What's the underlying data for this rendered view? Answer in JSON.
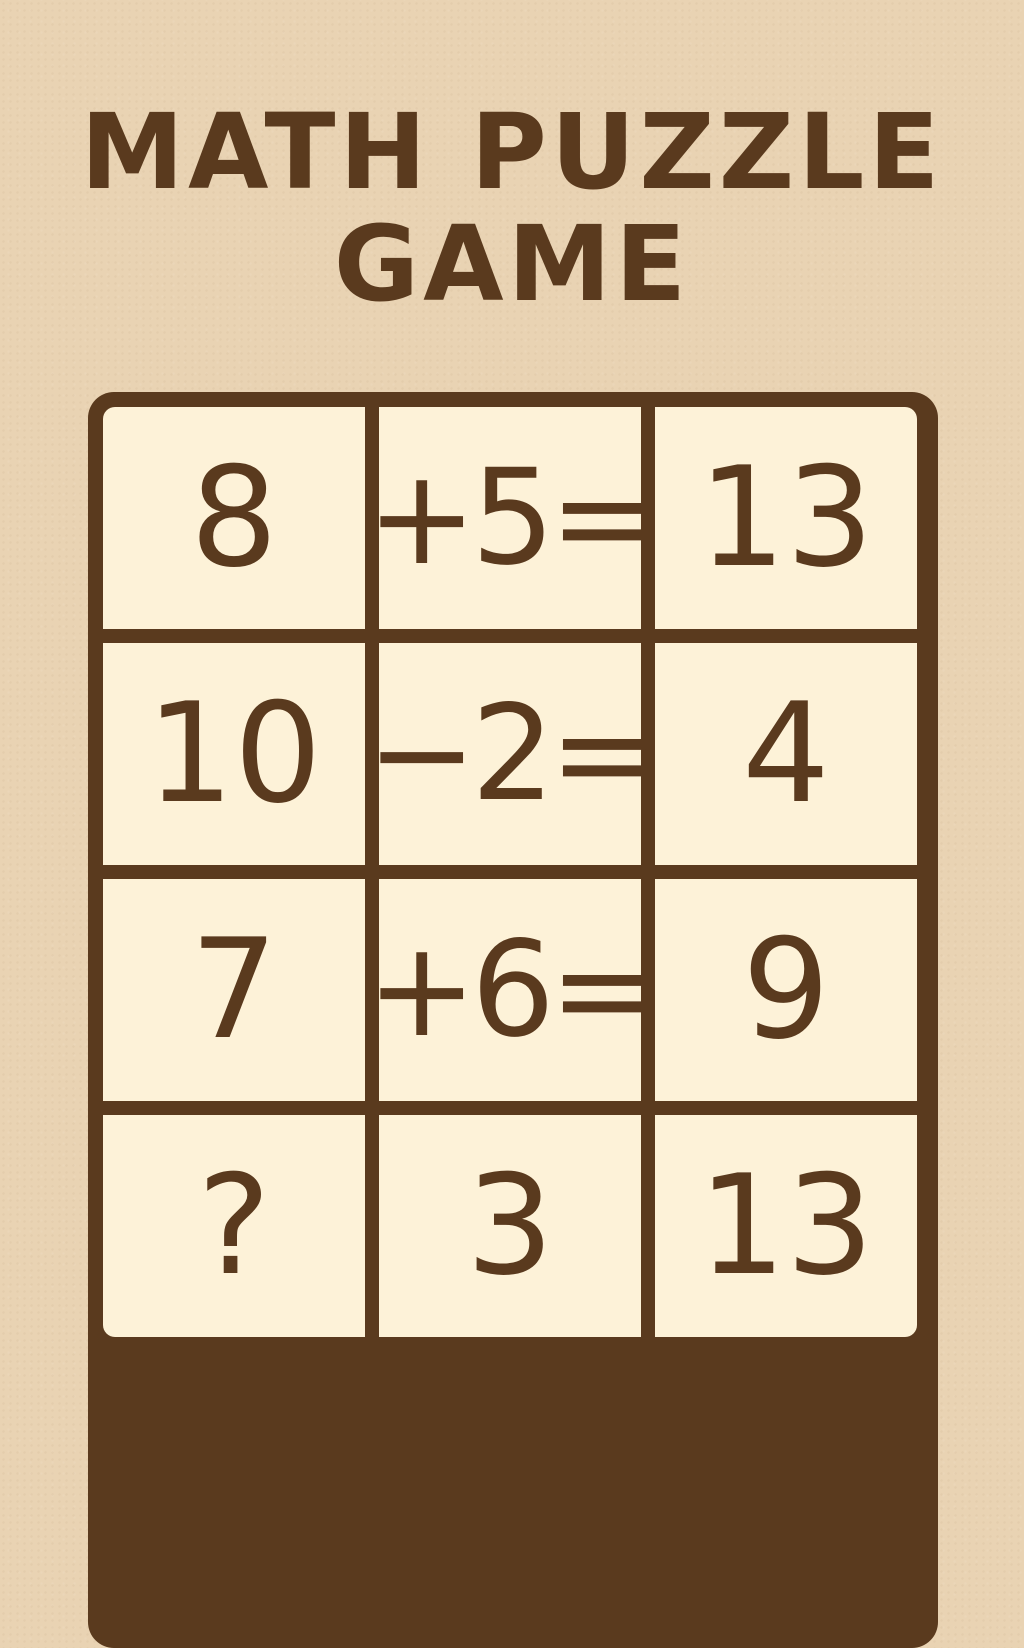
{
  "title": {
    "line1": "MATH PUZZLE",
    "line2": "GAME"
  },
  "grid": {
    "rows": [
      [
        "8",
        "+5=",
        "13"
      ],
      [
        "10",
        "−2=",
        "4"
      ],
      [
        "7",
        "+6=",
        "9"
      ],
      [
        "?",
        "3",
        "13"
      ]
    ]
  },
  "colors": {
    "background": "#e9d3b3",
    "cell": "#fdf2d8",
    "ink": "#5a3a1e"
  }
}
